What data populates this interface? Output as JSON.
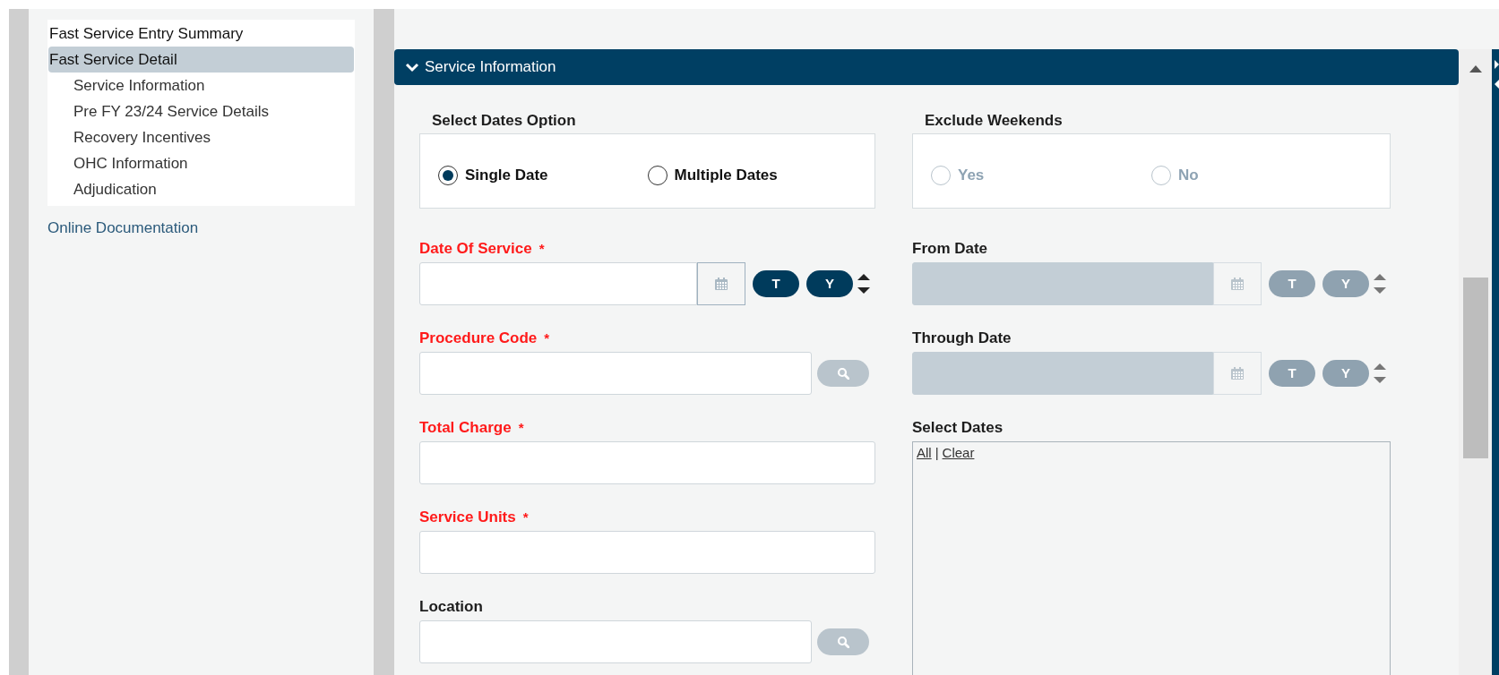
{
  "nav": {
    "items": [
      {
        "label": "Fast Service Entry Summary",
        "selected": false
      },
      {
        "label": "Fast Service Detail",
        "selected": true,
        "children": [
          {
            "label": "Service Information"
          },
          {
            "label": "Pre FY 23/24 Service Details"
          },
          {
            "label": "Recovery Incentives"
          },
          {
            "label": "OHC Information"
          },
          {
            "label": "Adjudication"
          }
        ]
      }
    ],
    "link": "Online Documentation"
  },
  "section": {
    "title": "Service Information",
    "expanded": true
  },
  "option_groups": [
    {
      "legend": "Select Dates Option",
      "disabled": false,
      "options": [
        {
          "label": "Single Date",
          "selected": true
        },
        {
          "label": "Multiple Dates",
          "selected": false
        }
      ]
    },
    {
      "legend": "Exclude Weekends",
      "disabled": true,
      "options": [
        {
          "label": "Yes",
          "selected": false
        },
        {
          "label": "No",
          "selected": false
        }
      ]
    }
  ],
  "left_fields": [
    {
      "kind": "date",
      "label": "Date Of Service",
      "required": true,
      "mark": "*",
      "disabled": false,
      "buttons": [
        "T",
        "Y"
      ]
    },
    {
      "kind": "lookup",
      "label": "Procedure Code",
      "required": true,
      "mark": "*"
    },
    {
      "kind": "text",
      "label": "Total Charge",
      "required": true,
      "mark": "*"
    },
    {
      "kind": "text",
      "label": "Service Units",
      "required": true,
      "mark": "*"
    },
    {
      "kind": "lookup",
      "label": "Location",
      "required": false
    }
  ],
  "right_fields": [
    {
      "kind": "date",
      "label": "From Date",
      "required": false,
      "disabled": true,
      "buttons": [
        "T",
        "Y"
      ]
    },
    {
      "kind": "date",
      "label": "Through Date",
      "required": false,
      "disabled": true,
      "buttons": [
        "T",
        "Y"
      ]
    },
    {
      "kind": "list",
      "label": "Select Dates",
      "required": false,
      "links": [
        "All",
        "Clear"
      ],
      "separator": "|"
    }
  ]
}
